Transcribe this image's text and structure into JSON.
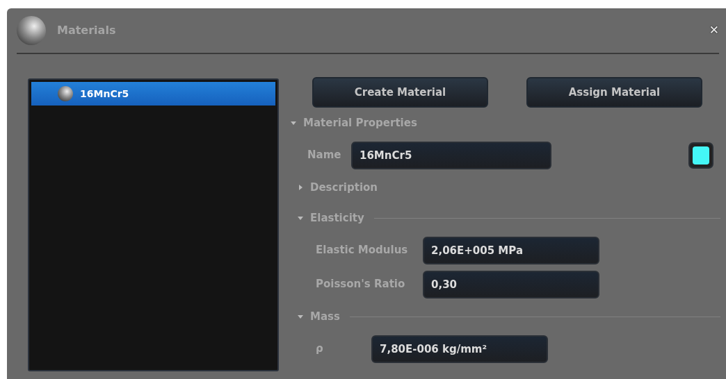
{
  "window": {
    "title": "Materials",
    "close": "✕"
  },
  "materials": [
    {
      "name": "16MnCr5",
      "selected": true
    }
  ],
  "buttons": [
    {
      "label": "Create Material"
    },
    {
      "label": "Assign Material"
    }
  ],
  "sections": [
    {
      "title": "Material Properties",
      "expanded": true,
      "divider": false,
      "fields": [
        {
          "label": "Name",
          "value": "16MnCr5"
        }
      ],
      "color": "#44f6f6"
    },
    {
      "title": "Description",
      "expanded": false,
      "divider": false
    },
    {
      "title": "Elasticity",
      "expanded": true,
      "divider": true,
      "fields": [
        {
          "label": "Elastic Modulus",
          "value": "2,06E+005 MPa"
        },
        {
          "label": "Poisson's Ratio",
          "value": "0,30"
        }
      ]
    },
    {
      "title": "Mass",
      "expanded": true,
      "divider": true,
      "fields": [
        {
          "label": "ρ",
          "value": "7,80E-006 kg/mm²"
        }
      ]
    }
  ]
}
